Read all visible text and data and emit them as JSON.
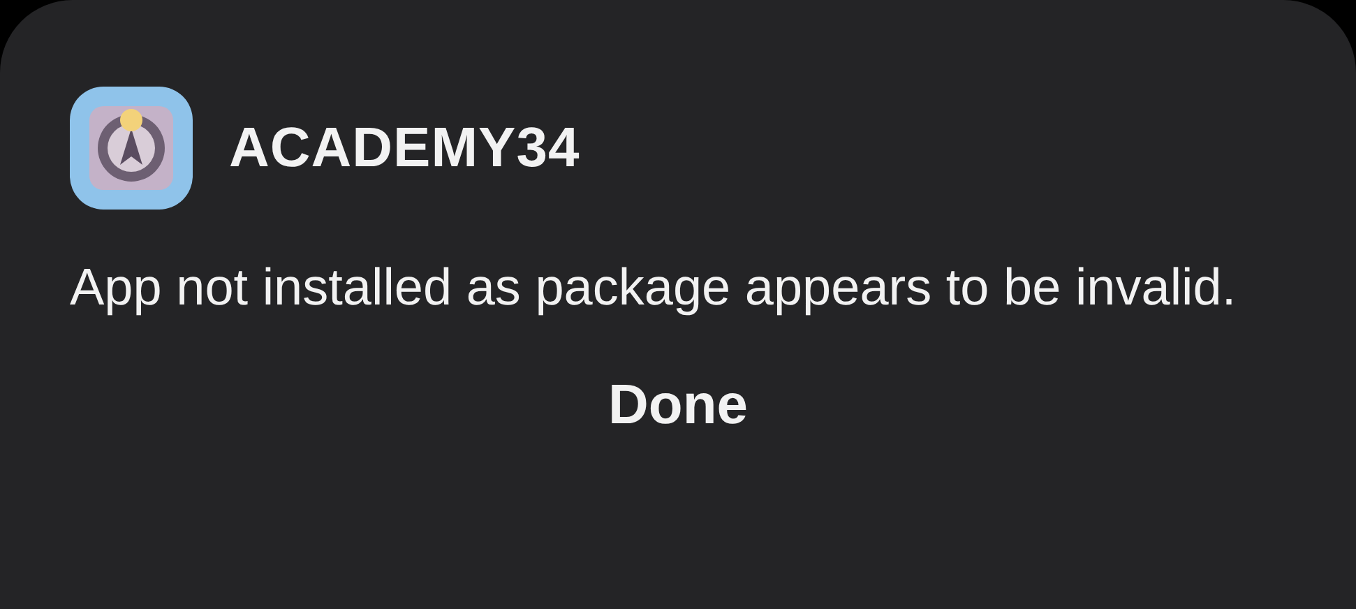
{
  "dialog": {
    "app_name": "ACADEMY34",
    "message": "App not installed as package appears to be invalid.",
    "buttons": [
      "Done"
    ]
  }
}
